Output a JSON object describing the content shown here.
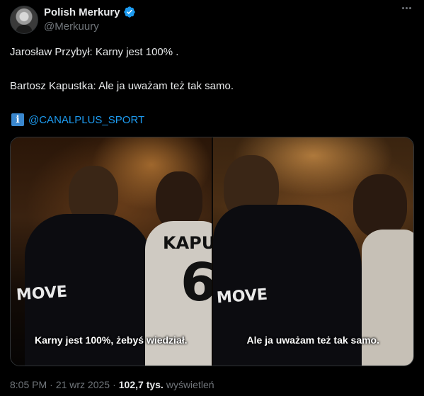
{
  "author": {
    "display_name": "Polish Merkury",
    "handle": "@Merkuury",
    "verified": true
  },
  "tweet": {
    "line1": "Jarosław Przybył: Karny jest 100% .",
    "line2": "Bartosz Kapustka: Ale ja uważam też tak samo.",
    "source_icon": "info-icon",
    "source_link": "@CANALPLUS_SPORT"
  },
  "media": {
    "left_subtitle": "Karny jest 100%, żebyś wiedział.",
    "right_subtitle": "Ale ja uważam też tak samo.",
    "left_shirt_text": "MOVE",
    "left_jersey_name": "KAPU",
    "left_jersey_number": "6",
    "right_shirt_text": "MOVE"
  },
  "meta": {
    "time": "8:05 PM",
    "separator1": "·",
    "date": "21 wrz 2025",
    "separator2": "·",
    "views_count": "102,7 tys.",
    "views_label": "wyświetleń"
  },
  "colors": {
    "background": "#000000",
    "text": "#e7e9ea",
    "muted": "#71767b",
    "link": "#1d9bf0",
    "verified": "#1d9bf0"
  }
}
